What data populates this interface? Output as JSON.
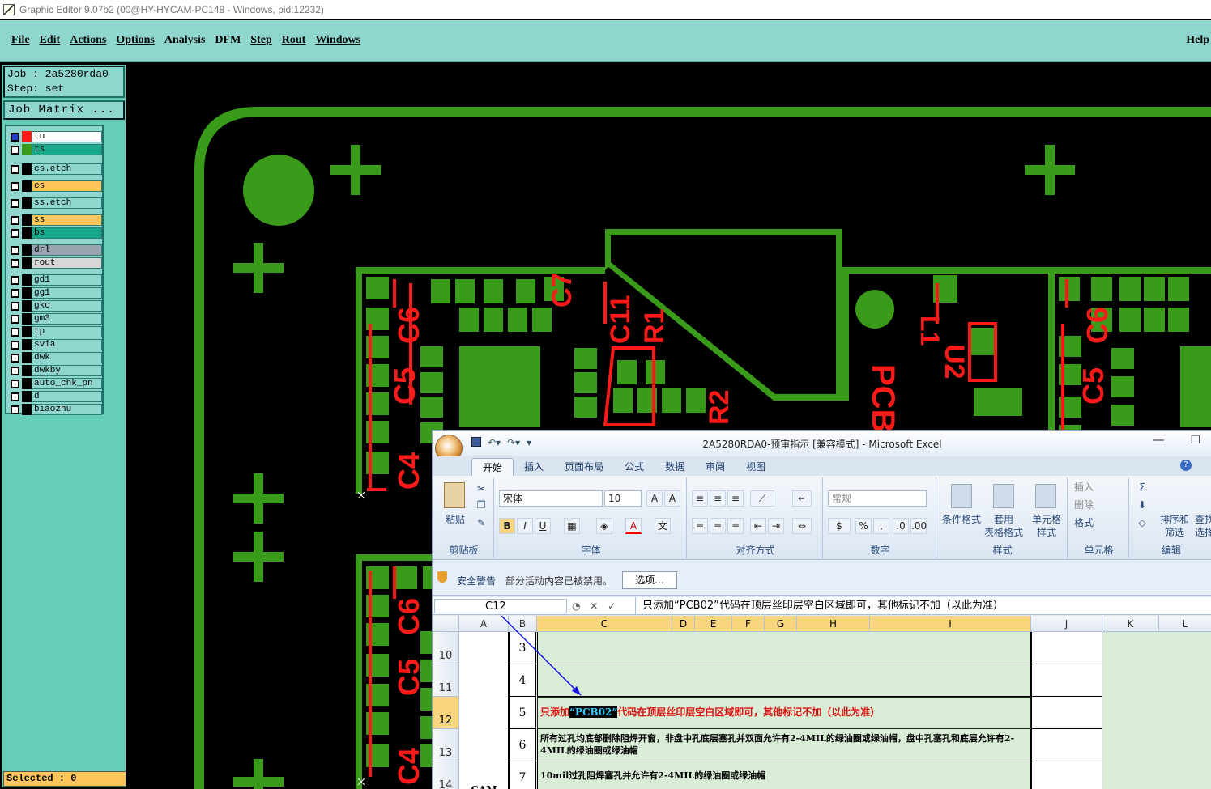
{
  "app_title": "Graphic Editor 9.07b2 (00@HY-HYCAM-PC148 - Windows, pid:12232)",
  "menu": [
    "File",
    "Edit",
    "Actions",
    "Options",
    "Analysis",
    "DFM",
    "Step",
    "Rout",
    "Windows"
  ],
  "help_label": "Help",
  "job_line": "Job : 2a5280rda0",
  "step_line": "Step: set",
  "job_matrix_label": "Job Matrix ...",
  "layers": [
    {
      "name": "to",
      "color": "#ffffff",
      "swatch": "#ff1a1a"
    },
    {
      "name": "ts",
      "color": "#1aa88a",
      "swatch": "#3a9a1a"
    },
    {
      "name": "cs.etch",
      "color": "#8fd6cf",
      "swatch": "#000000"
    },
    {
      "name": "cs",
      "color": "#ffc558",
      "swatch": "#000000"
    },
    {
      "name": "ss.etch",
      "color": "#8fd6cf",
      "swatch": "#000000"
    },
    {
      "name": "ss",
      "color": "#ffc558",
      "swatch": "#000000"
    },
    {
      "name": "bs",
      "color": "#1aa88a",
      "swatch": "#000000"
    },
    {
      "name": "drl",
      "color": "#9aa4b0",
      "swatch": "#000000"
    },
    {
      "name": "rout",
      "color": "#d8d8d8",
      "swatch": "#000000"
    },
    {
      "name": "gd1",
      "color": "#8fd6cf",
      "swatch": "#000000"
    },
    {
      "name": "gg1",
      "color": "#8fd6cf",
      "swatch": "#000000"
    },
    {
      "name": "gko",
      "color": "#8fd6cf",
      "swatch": "#000000"
    },
    {
      "name": "gm3",
      "color": "#8fd6cf",
      "swatch": "#000000"
    },
    {
      "name": "tp",
      "color": "#8fd6cf",
      "swatch": "#000000"
    },
    {
      "name": "svia",
      "color": "#8fd6cf",
      "swatch": "#000000"
    },
    {
      "name": "dwk",
      "color": "#8fd6cf",
      "swatch": "#000000"
    },
    {
      "name": "dwkby",
      "color": "#8fd6cf",
      "swatch": "#000000"
    },
    {
      "name": "auto_chk_pn",
      "color": "#8fd6cf",
      "swatch": "#000000"
    },
    {
      "name": "d",
      "color": "#8fd6cf",
      "swatch": "#000000"
    },
    {
      "name": "biaozhu",
      "color": "#8fd6cf",
      "swatch": "#000000"
    }
  ],
  "status": "Selected : 0",
  "pcb": {
    "labels": [
      "C7",
      "C11",
      "R1",
      "R2",
      "C6",
      "C5",
      "C4",
      "L1",
      "U2",
      "PCB"
    ],
    "colors": {
      "copper": "#3a9a1a",
      "silk": "#ff1a1a",
      "bg": "#000000"
    }
  },
  "excel": {
    "document_title": "2A5280RDA0-预审指示  [兼容模式]  - Microsoft Excel",
    "win_min": "—",
    "win_max": "☐",
    "tabs": [
      "开始",
      "插入",
      "页面布局",
      "公式",
      "数据",
      "审阅",
      "视图"
    ],
    "font_name": "宋体",
    "font_size": "10",
    "number_format": "常规",
    "group_labels": [
      "剪贴板",
      "字体",
      "对齐方式",
      "数字",
      "样式",
      "单元格",
      "编辑"
    ],
    "paste_label": "粘贴",
    "style_buttons": [
      "条件格式",
      "套用\n表格格式",
      "单元格\n样式"
    ],
    "cell_buttons": [
      "插入",
      "删除",
      "格式"
    ],
    "edit_buttons": [
      "排序和\n筛选",
      "查找\n选择"
    ],
    "security_title": "安全警告",
    "security_msg": "部分活动内容已被禁用。",
    "options_button": "选项...",
    "name_box": "C12",
    "formula": "只添加“PCB02”代码在顶层丝印层空白区域即可，其他标记不加（以此为准）",
    "columns": [
      "A",
      "B",
      "C",
      "D",
      "E",
      "F",
      "G",
      "H",
      "I",
      "J",
      "K",
      "L"
    ],
    "rows": [
      {
        "row": "10",
        "num": "3",
        "text": ""
      },
      {
        "row": "11",
        "num": "4",
        "text": ""
      },
      {
        "row": "12",
        "num": "5",
        "pre": "只添加",
        "hl": "“PCB02”",
        "post": "代码在顶层丝印层空白区域即可，其他标记不加（以此为准）"
      },
      {
        "row": "13",
        "num": "6",
        "text": "所有过孔均底部删除阻焊开窗，非盘中孔底层塞孔并双面允许有2-4MIL的绿油圈或绿油帽，盘中孔塞孔和底层允许有2-4MIL的绿油圈或绿油帽"
      },
      {
        "row": "14",
        "num": "7",
        "text": "10mil过孔阻焊塞孔并允许有2-4MIL的绿油圈或绿油帽",
        "a": "CAM"
      }
    ]
  }
}
